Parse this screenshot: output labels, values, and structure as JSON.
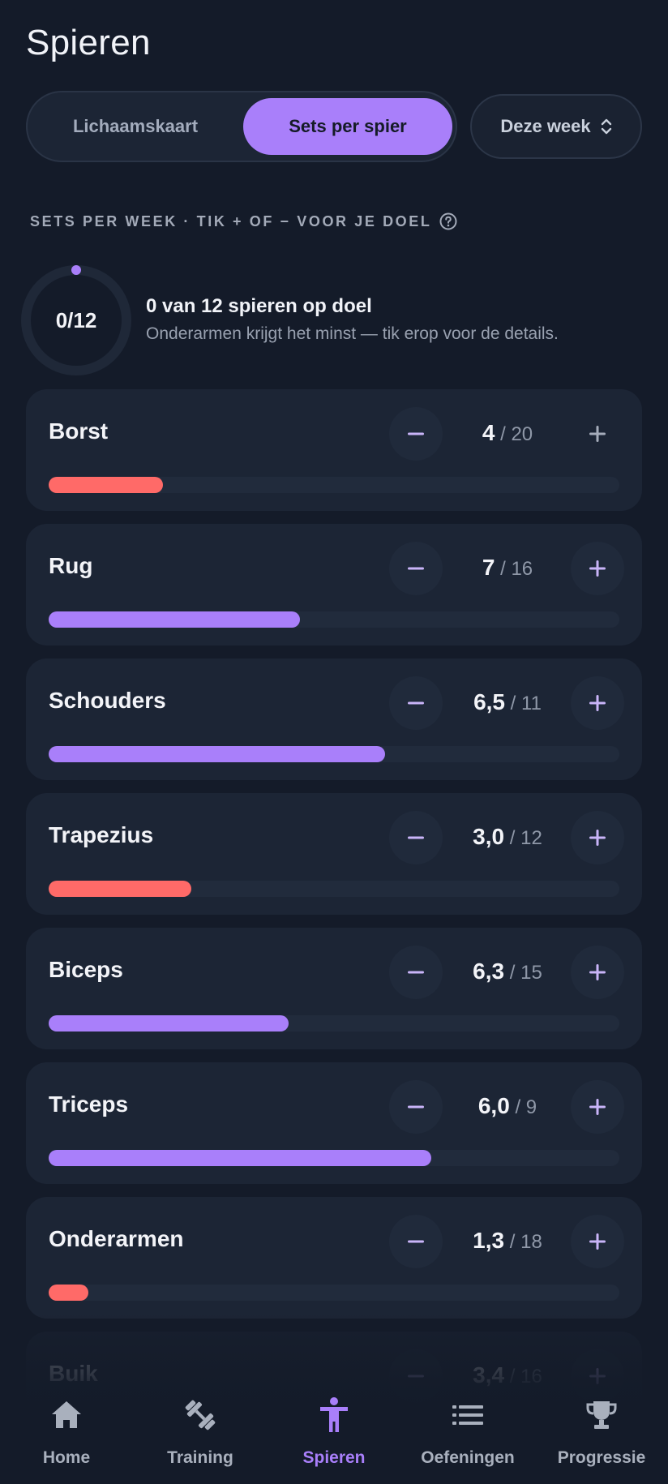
{
  "header": {
    "title": "Spieren"
  },
  "view_toggle": {
    "options": [
      {
        "label": "Lichaamskaart",
        "selected": false
      },
      {
        "label": "Sets per spier",
        "selected": true
      }
    ]
  },
  "period_select": {
    "value": "Deze week"
  },
  "section": {
    "label": "SETS PER WEEK · TIK + OF − VOOR JE DOEL"
  },
  "summary": {
    "ring_text": "0/12",
    "ring_progress": 0,
    "title": "0 van 12 spieren op doel",
    "subtitle": "Onderarmen krijgt het minst — tik erop voor de details."
  },
  "colors": {
    "accent": "#a97ffa",
    "below_target": "#ff6a68",
    "card": "#1c2535",
    "background": "#141b29"
  },
  "muscles": [
    {
      "name": "Borst",
      "value": "4",
      "goal": "20",
      "progress": 0.2,
      "status": "low"
    },
    {
      "name": "Rug",
      "value": "7",
      "goal": "16",
      "progress": 0.44,
      "status": "ok"
    },
    {
      "name": "Schouders",
      "value": "6,5",
      "goal": "11",
      "progress": 0.59,
      "status": "ok"
    },
    {
      "name": "Trapezius",
      "value": "3,0",
      "goal": "12",
      "progress": 0.25,
      "status": "low"
    },
    {
      "name": "Biceps",
      "value": "6,3",
      "goal": "15",
      "progress": 0.42,
      "status": "ok"
    },
    {
      "name": "Triceps",
      "value": "6,0",
      "goal": "9",
      "progress": 0.67,
      "status": "ok"
    },
    {
      "name": "Onderarmen",
      "value": "1,3",
      "goal": "18",
      "progress": 0.07,
      "status": "low"
    },
    {
      "name": "Buik",
      "value": "3,4",
      "goal": "16",
      "progress": 0.21,
      "status": "low"
    }
  ],
  "nav": [
    {
      "label": "Home",
      "icon": "home-icon",
      "active": false
    },
    {
      "label": "Training",
      "icon": "dumbbell-icon",
      "active": false
    },
    {
      "label": "Spieren",
      "icon": "person-icon",
      "active": true
    },
    {
      "label": "Oefeningen",
      "icon": "list-icon",
      "active": false
    },
    {
      "label": "Progressie",
      "icon": "trophy-icon",
      "active": false
    }
  ]
}
